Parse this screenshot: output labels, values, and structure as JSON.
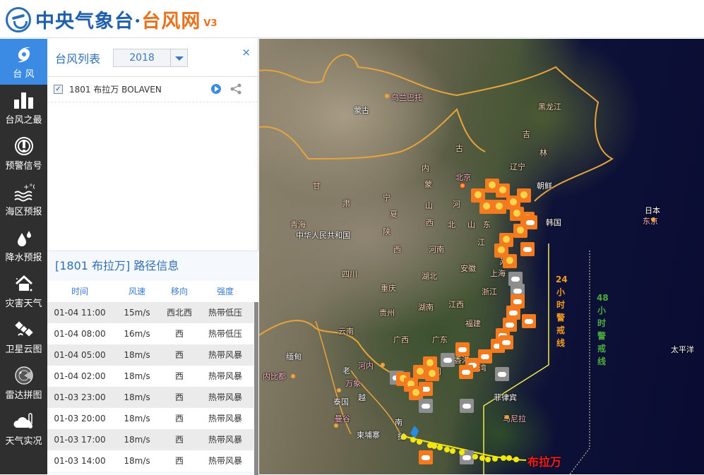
{
  "header": {
    "title_part1": "中央气象台·",
    "title_part2": "台风网",
    "version": "V3"
  },
  "sidebar": {
    "items": [
      {
        "label": "台 风",
        "icon": "typhoon-icon",
        "active": true
      },
      {
        "label": "台风之最",
        "icon": "bar-chart-icon",
        "active": false
      },
      {
        "label": "预警信号",
        "icon": "warning-signal-icon",
        "active": false
      },
      {
        "label": "海区预报",
        "icon": "sea-temperature-icon",
        "active": false
      },
      {
        "label": "降水预报",
        "icon": "raindrop-icon",
        "active": false
      },
      {
        "label": "灾害天气",
        "icon": "disaster-house-icon",
        "active": false
      },
      {
        "label": "卫星云图",
        "icon": "satellite-icon",
        "active": false
      },
      {
        "label": "雷达拼图",
        "icon": "radar-icon",
        "active": false
      },
      {
        "label": "天气实况",
        "icon": "cloud-thermometer-icon",
        "active": false
      }
    ]
  },
  "typhoon_list": {
    "title": "台风列表",
    "year": "2018",
    "close": "×",
    "items": [
      {
        "name": "1801 布拉万 BOLAVEN",
        "checked": true
      }
    ]
  },
  "route_info": {
    "title": "[1801 布拉万] 路径信息",
    "columns": [
      "时间",
      "风速",
      "移向",
      "强度"
    ],
    "rows": [
      [
        "01-04 11:00",
        "15m/s",
        "西北西",
        "热带低压"
      ],
      [
        "01-04 08:00",
        "16m/s",
        "西",
        "热带低压"
      ],
      [
        "01-04 05:00",
        "18m/s",
        "西",
        "热带风暴"
      ],
      [
        "01-04 02:00",
        "18m/s",
        "西",
        "热带风暴"
      ],
      [
        "01-03 23:00",
        "18m/s",
        "西",
        "热带风暴"
      ],
      [
        "01-03 20:00",
        "18m/s",
        "西",
        "热带风暴"
      ],
      [
        "01-03 17:00",
        "18m/s",
        "西",
        "热带风暴"
      ],
      [
        "01-03 14:00",
        "18m/s",
        "西",
        "热带风暴"
      ]
    ]
  },
  "map": {
    "countries": [
      "蒙古",
      "中华人民共和国",
      "朝鲜",
      "韩国",
      "日本",
      "缅甸",
      "老",
      "越",
      "挝",
      "南",
      "泰国",
      "柬埔寨",
      "菲律宾",
      "太平洋"
    ],
    "provinces": [
      "黑龙江",
      "吉",
      "林",
      "辽宁",
      "内",
      "蒙",
      "古",
      "甘",
      "肃",
      "宁",
      "夏",
      "青海",
      "山",
      "西",
      "河",
      "北",
      "山",
      "东",
      "江",
      "苏",
      "陕",
      "西",
      "河南",
      "安徽",
      "四川",
      "重庆",
      "湖北",
      "浙江",
      "贵州",
      "湖南",
      "江西",
      "福建",
      "云南",
      "广西",
      "广东",
      "香港",
      "澳门",
      "台湾",
      "上海"
    ],
    "cities": [
      "乌兰巴托",
      "北京",
      "东京",
      "河内",
      "万象",
      "内比都",
      "曼谷",
      "马尼拉"
    ],
    "warning_24h": {
      "number": "24",
      "text": "小时警戒线",
      "color": "#f39c1f"
    },
    "warning_48h": {
      "number": "48",
      "text": "小时警戒线",
      "color": "#4caf3a"
    },
    "typhoon_label": "布拉万"
  }
}
